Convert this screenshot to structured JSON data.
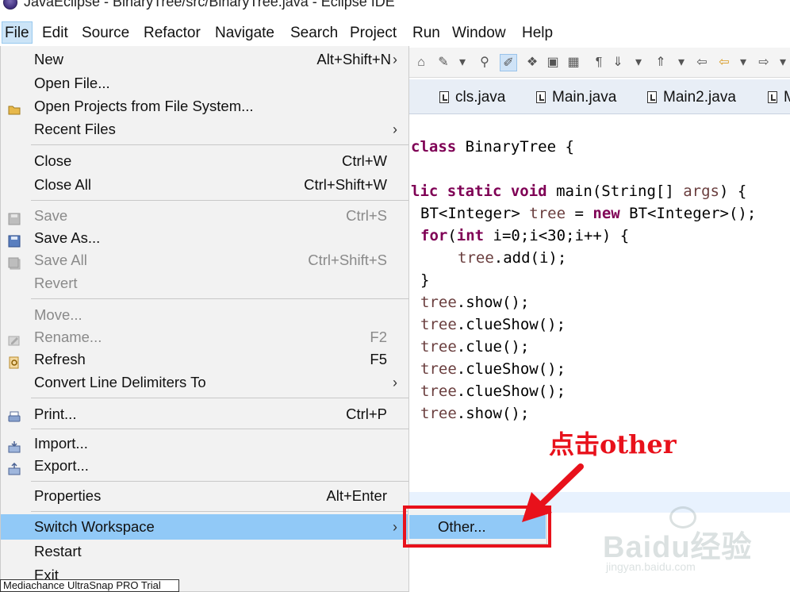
{
  "window": {
    "title": "JavaEclipse - BinaryTree/src/BinaryTree.java - Eclipse IDE"
  },
  "menubar": {
    "items": [
      "File",
      "Edit",
      "Source",
      "Refactor",
      "Navigate",
      "Search",
      "Project",
      "Run",
      "Window",
      "Help"
    ],
    "active": "File"
  },
  "tabs": [
    "cls.java",
    "Main.java",
    "Main2.java",
    "M"
  ],
  "code": {
    "line1": {
      "kw": "class",
      "rest": " BinaryTree {"
    },
    "line2": {
      "pre": "lic ",
      "kw1": "static",
      "kw2": "void",
      "rest1": " main(String[] ",
      "var": "args",
      "rest2": ") {"
    },
    "line3": {
      "pre": "BT<Integer> ",
      "var": "tree",
      "mid": " = ",
      "kw": "new",
      "rest": " BT<Integer>();"
    },
    "line4": {
      "kw1": "for",
      "mid1": "(",
      "kw2": "int",
      "rest": " i=0;i<30;i++) {"
    },
    "line5": {
      "var": "tree",
      "rest": ".add(i);"
    },
    "line6": "}",
    "calls": [
      {
        "var": "tree",
        "rest": ".show();"
      },
      {
        "var": "tree",
        "rest": ".clueShow();"
      },
      {
        "var": "tree",
        "rest": ".clue();"
      },
      {
        "var": "tree",
        "rest": ".clueShow();"
      },
      {
        "var": "tree",
        "rest": ".clueShow();"
      },
      {
        "var": "tree",
        "rest": ".show();"
      }
    ]
  },
  "file_menu": {
    "new": {
      "label": "New",
      "shortcut": "Alt+Shift+N"
    },
    "open_file": {
      "label": "Open File..."
    },
    "open_projects": {
      "label": "Open Projects from File System..."
    },
    "recent_files": {
      "label": "Recent Files"
    },
    "close": {
      "label": "Close",
      "shortcut": "Ctrl+W"
    },
    "close_all": {
      "label": "Close All",
      "shortcut": "Ctrl+Shift+W"
    },
    "save": {
      "label": "Save",
      "shortcut": "Ctrl+S"
    },
    "save_as": {
      "label": "Save As..."
    },
    "save_all": {
      "label": "Save All",
      "shortcut": "Ctrl+Shift+S"
    },
    "revert": {
      "label": "Revert"
    },
    "move": {
      "label": "Move..."
    },
    "rename": {
      "label": "Rename...",
      "shortcut": "F2"
    },
    "refresh": {
      "label": "Refresh",
      "shortcut": "F5"
    },
    "convert": {
      "label": "Convert Line Delimiters To"
    },
    "print": {
      "label": "Print...",
      "shortcut": "Ctrl+P"
    },
    "import": {
      "label": "Import..."
    },
    "export": {
      "label": "Export..."
    },
    "properties": {
      "label": "Properties",
      "shortcut": "Alt+Enter"
    },
    "switch_workspace": {
      "label": "Switch Workspace"
    },
    "restart": {
      "label": "Restart"
    },
    "exit": {
      "label": "Exit"
    }
  },
  "submenu": {
    "other": "Other..."
  },
  "annotation": {
    "text": "点击other",
    "color": "#e8111b"
  },
  "watermark": {
    "brand": "Baidu经验",
    "url": "jingyan.baidu.com"
  },
  "trial_bar": "Mediachance UltraSnap PRO Trial"
}
